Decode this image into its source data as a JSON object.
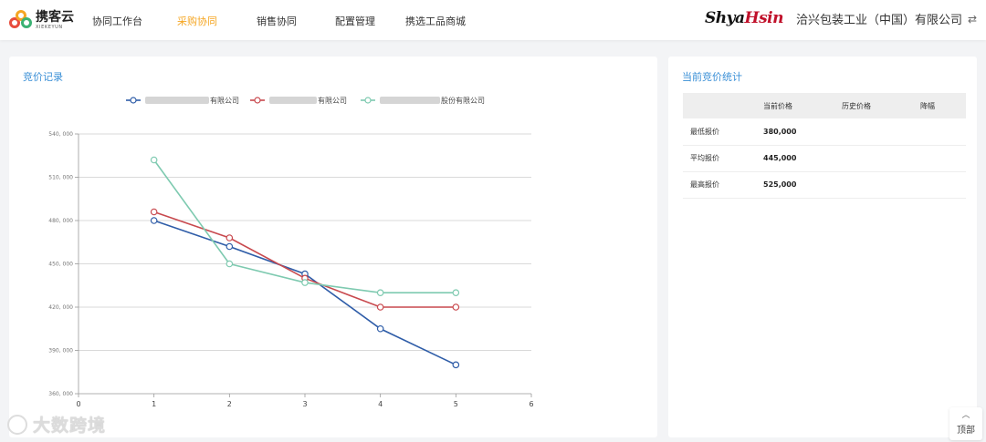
{
  "logo": {
    "name": "携客云",
    "sub": "XIEKEYUN"
  },
  "nav": {
    "items": [
      {
        "label": "协同工作台",
        "active": false
      },
      {
        "label": "采购协同",
        "active": true
      },
      {
        "label": "销售协同",
        "active": false
      },
      {
        "label": "配置管理",
        "active": false
      },
      {
        "label": "携选工品商城",
        "active": false
      }
    ]
  },
  "brand": {
    "logo_main": "Shya",
    "logo_accent": "Hsin",
    "company": "洽兴包装工业（中国）有限公司"
  },
  "icons": {
    "switch": "switch-arrows-icon",
    "back_top": "chevron-up-icon",
    "watermark": "watermark-logo-icon"
  },
  "colors": {
    "accent": "#f5a623",
    "title_blue": "#3a8fd6",
    "series1": "#2f5da8",
    "series2": "#c8494e",
    "series3": "#7ecab0"
  },
  "left_panel": {
    "title": "竞价记录"
  },
  "chart_data": {
    "type": "line",
    "x": [
      1,
      2,
      3,
      4,
      5
    ],
    "xlim": [
      0,
      6
    ],
    "ylim": [
      360000,
      540000
    ],
    "y_ticks": [
      360000,
      390000,
      420000,
      450000,
      480000,
      510000,
      540000
    ],
    "y_tick_labels": [
      "360, 000",
      "390, 000",
      "420, 000",
      "450, 000",
      "480, 000",
      "510, 000",
      "540, 000"
    ],
    "x_tick_labels": [
      "0",
      "1",
      "2",
      "3",
      "4",
      "5",
      "6"
    ],
    "grid": "horizontal",
    "legend_position": "top-center",
    "series": [
      {
        "name": "有限公司",
        "color": "#2f5da8",
        "values": [
          480000,
          462000,
          443000,
          405000,
          380000
        ]
      },
      {
        "name": "有限公司",
        "color": "#c8494e",
        "values": [
          486000,
          468000,
          440000,
          420000,
          420000
        ]
      },
      {
        "name": "股份有限公司",
        "color": "#7ecab0",
        "values": [
          522000,
          450000,
          437000,
          430000,
          430000
        ]
      }
    ]
  },
  "right_panel": {
    "title": "当前竞价统计",
    "headers": [
      "",
      "当前价格",
      "历史价格",
      "降幅"
    ],
    "rows": [
      {
        "label": "最低报价",
        "current": "380,000",
        "history": "",
        "drop": ""
      },
      {
        "label": "平均报价",
        "current": "445,000",
        "history": "",
        "drop": ""
      },
      {
        "label": "最高报价",
        "current": "525,000",
        "history": "",
        "drop": ""
      }
    ]
  },
  "watermark": {
    "text": "大数跨境"
  },
  "back_top": {
    "label": "顶部"
  }
}
